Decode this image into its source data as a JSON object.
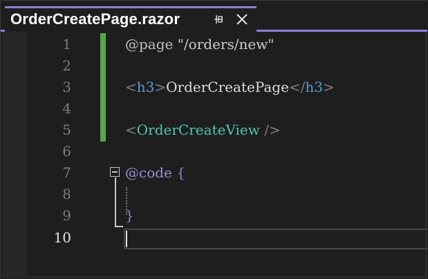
{
  "tab": {
    "title": "OrderCreatePage.razor",
    "pin_icon": "pin-icon",
    "close_icon": "close-icon"
  },
  "editor": {
    "line_numbers": [
      "1",
      "2",
      "3",
      "4",
      "5",
      "6",
      "7",
      "8",
      "9",
      "10"
    ],
    "current_line": "10",
    "lines": {
      "l1_at": "@page",
      "l1_str": " \"/orders/new\"",
      "l3_open_lt": "<",
      "l3_open_name": "h3",
      "l3_open_gt": ">",
      "l3_text": "OrderCreatePage",
      "l3_close_lt": "</",
      "l3_close_name": "h3",
      "l3_close_gt": ">",
      "l5_lt": "<",
      "l5_name": "OrderCreateView",
      "l5_end": " />",
      "l7_at": "@code",
      "l7_brace": " {",
      "l9_brace": "}"
    },
    "colors": {
      "change_bar": "#57a64a",
      "accent": "#8a7fd6",
      "component": "#4ec9b0",
      "html_tag": "#569cd6"
    }
  }
}
